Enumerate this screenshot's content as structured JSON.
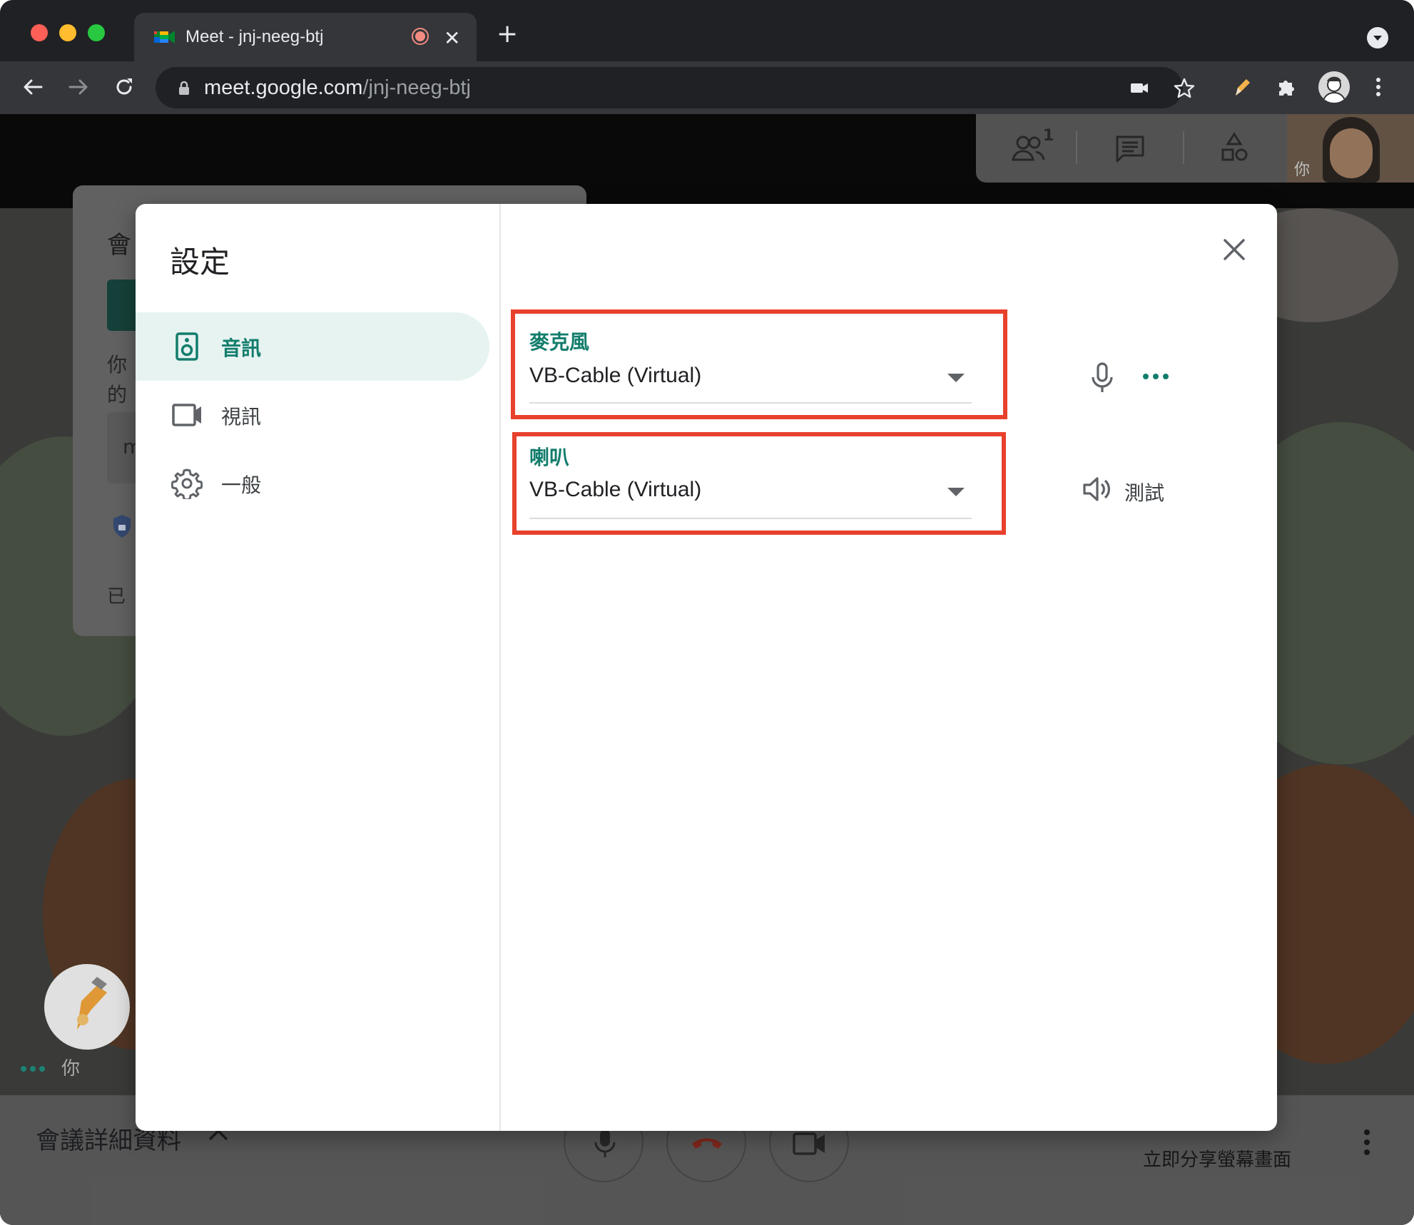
{
  "browser": {
    "tab_title": "Meet - jnj-neeg-btj",
    "url_host": "meet.google.com",
    "url_path": "/jnj-neeg-btj"
  },
  "meet": {
    "participant_count": "1",
    "self_label": "你",
    "bottom_you_label": "你",
    "meeting_details": "會議詳細資料",
    "present_now": "立即分享螢幕畫面",
    "left_card_fragments": [
      "會",
      "你",
      "的",
      "m",
      "已"
    ]
  },
  "settings": {
    "title": "設定",
    "nav": [
      {
        "label": "音訊",
        "icon": "speaker-icon",
        "active": true
      },
      {
        "label": "視訊",
        "icon": "video-icon",
        "active": false
      },
      {
        "label": "一般",
        "icon": "gear-icon",
        "active": false
      }
    ],
    "microphone": {
      "label": "麥克風",
      "value": "VB-Cable (Virtual)"
    },
    "speaker": {
      "label": "喇叭",
      "value": "VB-Cable (Virtual)",
      "test_label": "測試"
    }
  },
  "colors": {
    "accent": "#137d6c",
    "highlight_box": "#e8412d",
    "nav_active_bg": "#e6f3f1"
  }
}
